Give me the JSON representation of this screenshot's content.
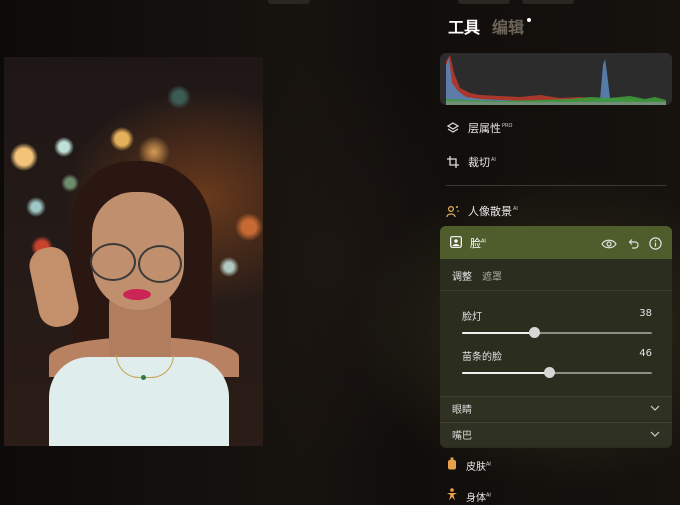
{
  "tabs": {
    "tools": "工具",
    "edit": "编辑"
  },
  "tools": [
    {
      "label": "层属性",
      "badge": "PRO",
      "icon": "layers-icon"
    },
    {
      "label": "裁切",
      "badge": "AI",
      "icon": "crop-icon"
    },
    {
      "label": "人像散景",
      "badge": "AI",
      "icon": "portrait-bokeh-icon"
    }
  ],
  "face_panel": {
    "title": "脸",
    "badge": "AI",
    "subtabs": [
      "调整",
      "遮罩"
    ],
    "sliders": [
      {
        "label": "脸灯",
        "value": 38
      },
      {
        "label": "苗条的脸",
        "value": 46
      }
    ],
    "rows": [
      "眼睛",
      "嘴巴"
    ]
  },
  "bottom_tools": [
    {
      "label": "皮肤",
      "badge": "AI",
      "icon": "skin-bottle-icon"
    },
    {
      "label": "身体",
      "badge": "AI",
      "icon": "body-figure-icon"
    }
  ],
  "histogram": {
    "colors": {
      "blue": "#5a7fb0",
      "red": "#c0392b",
      "green": "#3b9a3b",
      "gray": "#8a8a8a"
    }
  },
  "accent": "#4f5d2c"
}
